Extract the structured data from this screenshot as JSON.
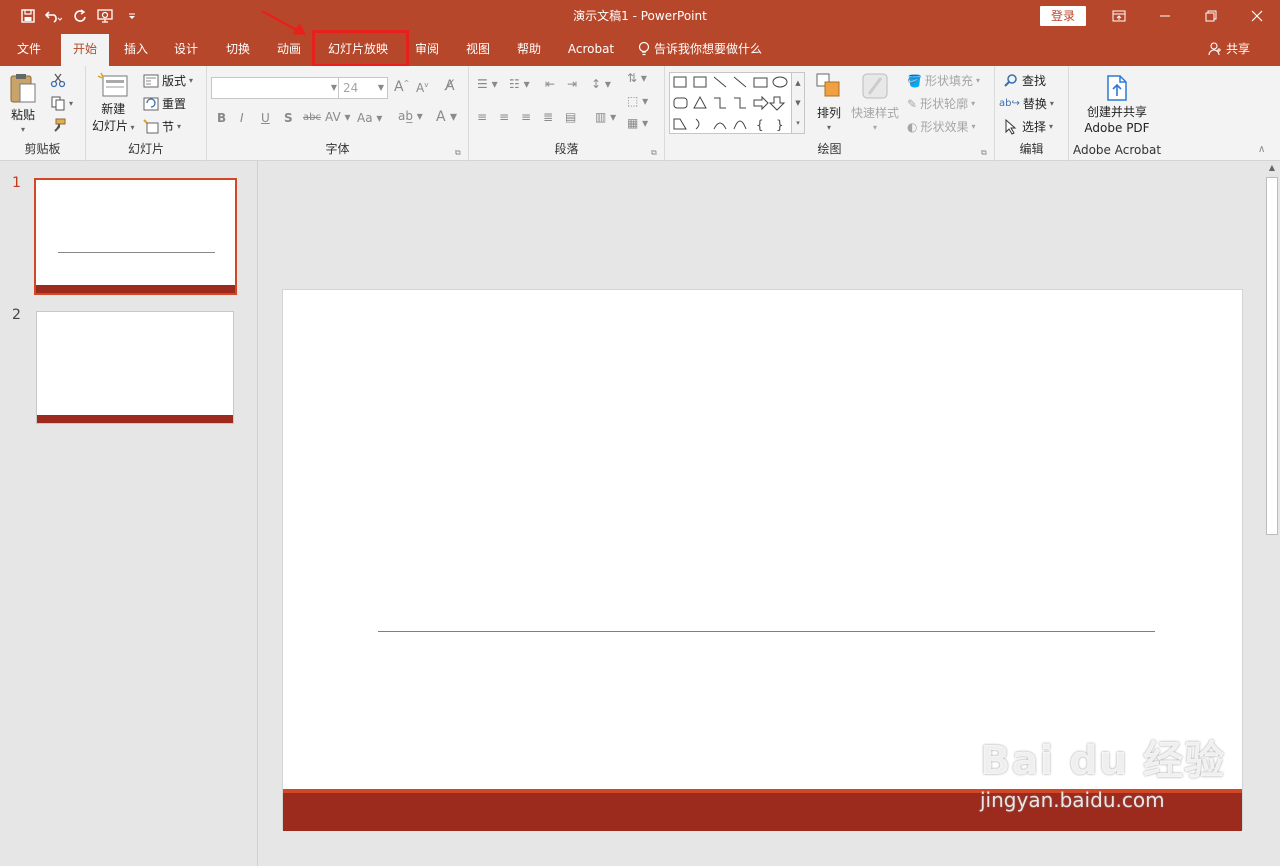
{
  "titlebar": {
    "doc_title": "演示文稿1  -  PowerPoint",
    "login_label": "登录",
    "qat": [
      "save-icon",
      "undo-icon",
      "redo-icon",
      "present-from-start-icon",
      "customize-qat-icon"
    ]
  },
  "tabs": [
    "文件",
    "开始",
    "插入",
    "设计",
    "切换",
    "动画",
    "幻灯片放映",
    "审阅",
    "视图",
    "帮助",
    "Acrobat"
  ],
  "tell_me": "告诉我你想要做什么",
  "share_label": "共享",
  "ribbon": {
    "clipboard": {
      "label": "剪贴板",
      "paste": "粘贴"
    },
    "slides": {
      "label": "幻灯片",
      "new_slide_1": "新建",
      "new_slide_2": "幻灯片",
      "layout": "版式",
      "reset": "重置",
      "section": "节"
    },
    "font": {
      "label": "字体",
      "font_name": "",
      "font_size": "24"
    },
    "paragraph": {
      "label": "段落"
    },
    "drawing": {
      "label": "绘图",
      "arrange": "排列",
      "quick_styles": "快速样式",
      "shape_fill": "形状填充",
      "shape_outline": "形状轮廓",
      "shape_effects": "形状效果"
    },
    "editing": {
      "label": "编辑",
      "find": "查找",
      "replace": "替换",
      "select": "选择"
    },
    "acrobat": {
      "label": "Adobe Acrobat",
      "create_1": "创建并共享",
      "create_2": "Adobe PDF"
    }
  },
  "slides": [
    {
      "number": "1"
    },
    {
      "number": "2"
    }
  ],
  "watermark": {
    "line1": "Bai du 经验",
    "line2": "jingyan.baidu.com"
  },
  "colors": {
    "accent": "#b7472a",
    "slide_band": "#9c2a1d",
    "band_top": "#d24726",
    "highlight": "#e8201b"
  }
}
